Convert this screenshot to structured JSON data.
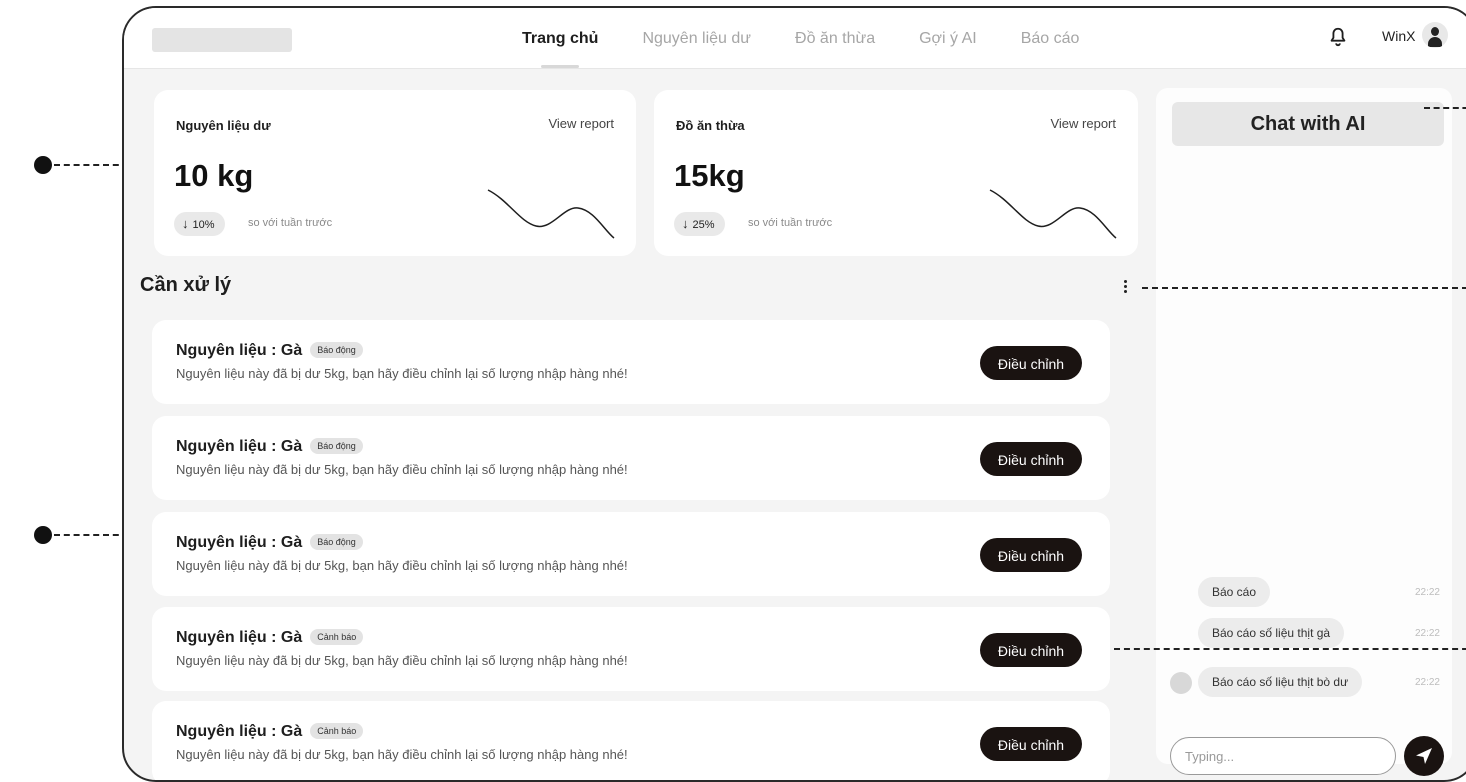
{
  "nav": {
    "items": [
      {
        "label": "Trang chủ",
        "active": true
      },
      {
        "label": "Nguyên liệu dư",
        "active": false
      },
      {
        "label": "Đồ ăn thừa",
        "active": false
      },
      {
        "label": "Gợi ý AI",
        "active": false
      },
      {
        "label": "Báo cáo",
        "active": false
      }
    ],
    "notification_icon": "bell-icon",
    "username": "WinX"
  },
  "stats": [
    {
      "title": "Nguyên liệu dư",
      "link": "View report",
      "value": "10 kg",
      "change": "10%",
      "change_direction": "down",
      "compare_text": "so với tuần trước"
    },
    {
      "title": "Đồ ăn thừa",
      "link": "View report",
      "value": "15kg",
      "change": "25%",
      "change_direction": "down",
      "compare_text": "so với tuần trước"
    }
  ],
  "tasks": {
    "title": "Cần xử lý",
    "more_icon": "kebab-icon",
    "items": [
      {
        "title": "Nguyên liệu : Gà",
        "tag": "Báo động",
        "desc": "Nguyên liệu này đã bị dư 5kg, bạn hãy điều chỉnh lại số lượng nhập hàng nhé!",
        "action": "Điều chỉnh"
      },
      {
        "title": "Nguyên liệu : Gà",
        "tag": "Báo động",
        "desc": "Nguyên liệu này đã bị dư 5kg, bạn hãy điều chỉnh lại số lượng nhập hàng nhé!",
        "action": "Điều chỉnh"
      },
      {
        "title": "Nguyên liệu : Gà",
        "tag": "Báo động",
        "desc": "Nguyên liệu này đã bị dư 5kg, bạn hãy điều chỉnh lại số lượng nhập hàng nhé!",
        "action": "Điều chỉnh"
      },
      {
        "title": "Nguyên liệu : Gà",
        "tag": "Cảnh báo",
        "desc": "Nguyên liệu này đã bị dư 5kg, bạn hãy điều chỉnh lại số lượng nhập hàng nhé!",
        "action": "Điều chỉnh"
      },
      {
        "title": "Nguyên liệu : Gà",
        "tag": "Cảnh báo",
        "desc": "Nguyên liệu này đã bị dư 5kg, bạn hãy điều chỉnh lại số lượng nhập hàng nhé!",
        "action": "Điều chỉnh"
      }
    ]
  },
  "chat": {
    "title": "Chat with AI",
    "messages": [
      {
        "text": "Báo cáo",
        "time": "22:22"
      },
      {
        "text": "Báo cáo số liệu thịt gà",
        "time": "22:22"
      },
      {
        "text": "Báo cáo số liệu thịt bò dư",
        "time": "22:22"
      }
    ],
    "input_placeholder": "Typing...",
    "send_icon": "send-icon"
  },
  "colors": {
    "accent_dark": "#1a1311",
    "background": "#f4f4f4",
    "card": "#ffffff",
    "muted_text": "#a6a6a6"
  }
}
